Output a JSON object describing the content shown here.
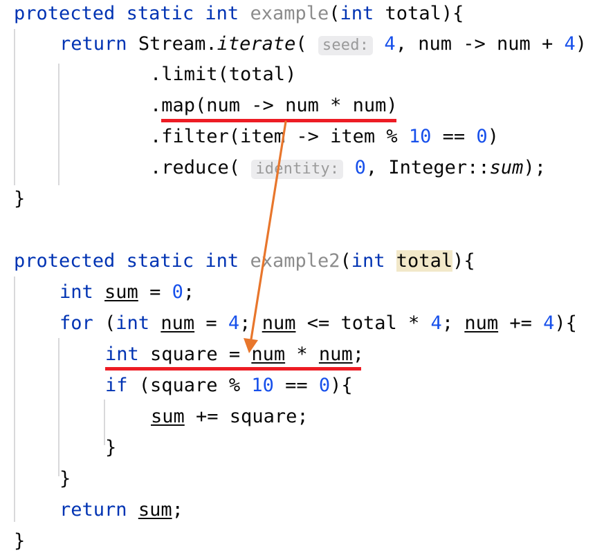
{
  "editor": {
    "language": "Java",
    "theme": "IntelliJ Light",
    "background_color": "#FFFFFF",
    "font_family_kind": "monospace",
    "colors": {
      "keyword": "#0033B3",
      "number": "#1750EB",
      "method_declaration": "#8C8C8C",
      "plain_text": "#080808",
      "inlay_hint_text": "#9A9A9A",
      "inlay_hint_background": "#ECECEE",
      "identifier_highlight": "#F2E8C9",
      "indent_guide": "#D8D8DA",
      "annotation_underline": "#ED1C24",
      "annotation_arrow": "#E8762C"
    }
  },
  "code": {
    "line01": {
      "kw_protected": "protected",
      "kw_static": "static",
      "kw_int": "int",
      "method_name": "example",
      "open_paren": "(",
      "param_type": "int",
      "param_name": "total",
      "tail": "){"
    },
    "line02": {
      "kw_return": "return",
      "receiver": "Stream.",
      "method": "iterate",
      "open_paren": "( ",
      "hint_seed": "seed:",
      "arg_seed": "4",
      "lambda": ", num -> num + ",
      "arg_step": "4",
      "close_paren": ")"
    },
    "line03": {
      "text": ".limit(total)"
    },
    "line04": {
      "prefix": ".map(num -> num * num)",
      "underlined": true
    },
    "line05": {
      "a": ".filter(item -> item % ",
      "n1": "10",
      "b": " == ",
      "n2": "0",
      "c": ")"
    },
    "line06": {
      "a": ".reduce( ",
      "hint_identity": "identity:",
      "n1": "0",
      "b": ", Integer::",
      "ital": "sum",
      "c": ");"
    },
    "line07": {
      "text": "}"
    },
    "line08": {
      "text": ""
    },
    "line09": {
      "kw_protected": "protected",
      "kw_static": "static",
      "kw_int": "int",
      "method_name": "example2",
      "open_paren": "(",
      "param_type": "int",
      "param_name": "total",
      "tail": "){"
    },
    "line10": {
      "kw_int": "int",
      "var": "sum",
      "eq": " = ",
      "n": "0",
      "semi": ";"
    },
    "line11": {
      "kw_for": "for",
      "a": " (",
      "kw_int": "int",
      "v1": "num",
      "b": " = ",
      "n1": "4",
      "c": "; ",
      "v2": "num",
      "d": " <= total * ",
      "n2": "4",
      "e": "; ",
      "v3": "num",
      "f": " += ",
      "n3": "4",
      "g": "){"
    },
    "line12": {
      "kw_int": "int",
      "a": " square = ",
      "v1": "num",
      "b": " * ",
      "v2": "num",
      "c": ";",
      "underlined": true
    },
    "line13": {
      "kw_if": "if",
      "a": " (square % ",
      "n1": "10",
      "b": " == ",
      "n2": "0",
      "c": "){"
    },
    "line14": {
      "v": "sum",
      "a": " += square;"
    },
    "line15": {
      "text": "}"
    },
    "line16": {
      "text": "}"
    },
    "line17": {
      "kw_return": "return",
      "v": "sum",
      "semi": ";"
    },
    "line18": {
      "text": "}"
    }
  },
  "annotations": {
    "underline_map": {
      "label": "red-underline-map-expression"
    },
    "underline_square": {
      "label": "red-underline-square-statement"
    },
    "arrow": {
      "label": "orange-arrow-map-to-square",
      "color": "#E8762C"
    }
  }
}
